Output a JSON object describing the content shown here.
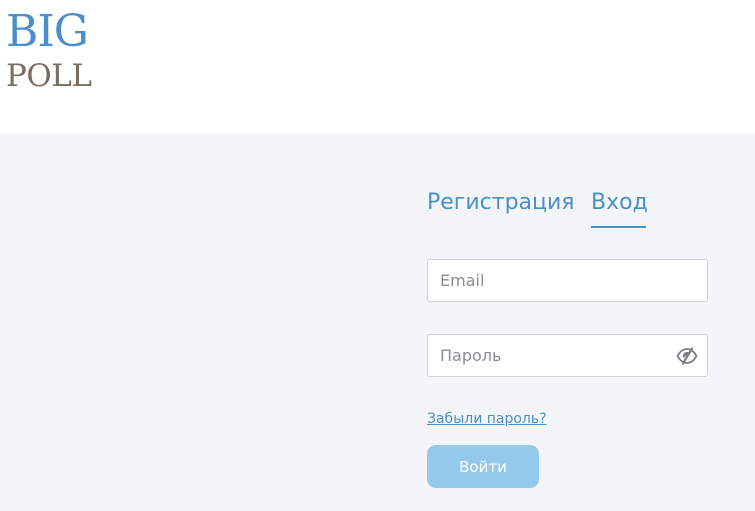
{
  "logo": {
    "line1": "BIG",
    "line2": "POLL"
  },
  "tabs": {
    "register_label": "Регистрация",
    "login_label": "Вход",
    "active": "login"
  },
  "form": {
    "email_placeholder": "Email",
    "email_value": "",
    "password_placeholder": "Пароль",
    "password_value": "",
    "forgot_password_label": "Забыли пароль?",
    "submit_label": "Войти"
  },
  "colors": {
    "accent": "#4a90c8",
    "logo_blue": "#4a8fcc",
    "logo_brown": "#7a6e5e",
    "button_bg": "#95c9ec",
    "page_bg": "#f4f5f9"
  },
  "icons": {
    "password_toggle": "eye-slash-icon"
  }
}
